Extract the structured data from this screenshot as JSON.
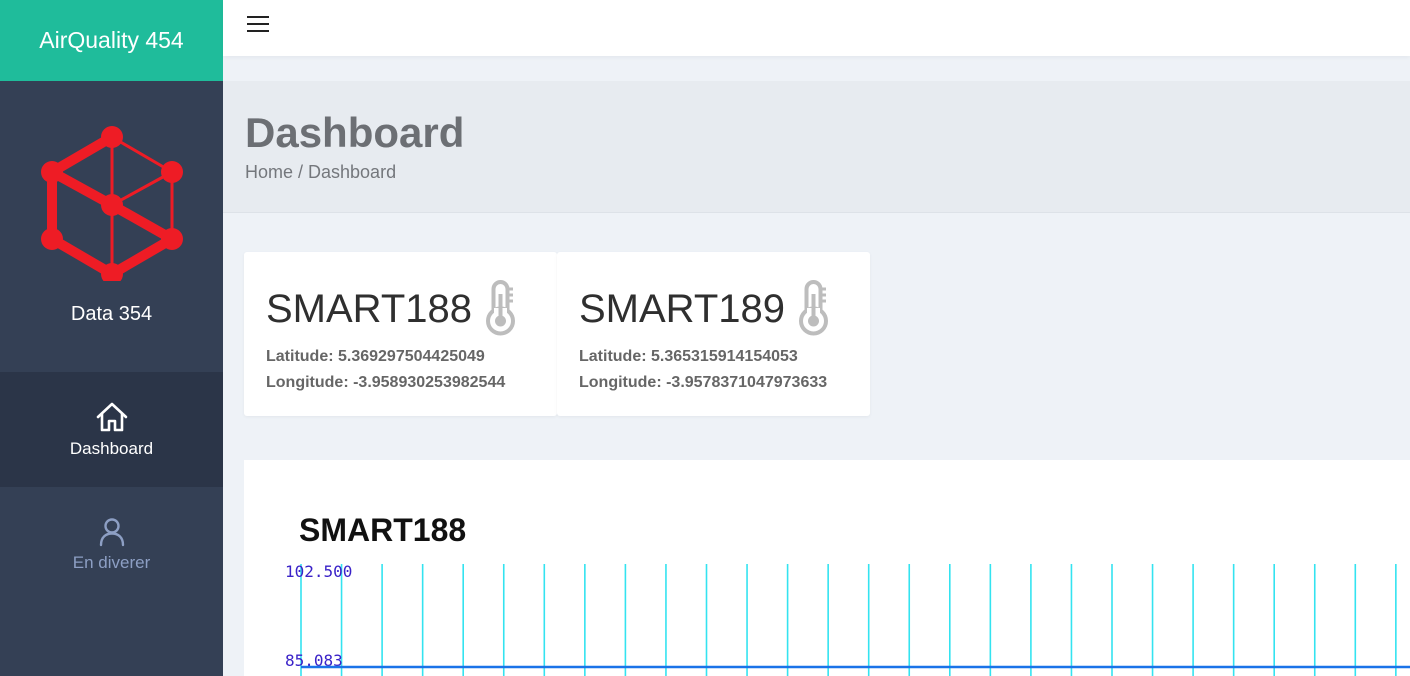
{
  "app": {
    "title": "AirQuality 454"
  },
  "sidebar": {
    "logo_label": "Data 354",
    "items": [
      {
        "label": "Dashboard",
        "icon": "home-icon",
        "active": true
      },
      {
        "label": "En diverer",
        "icon": "user-icon",
        "active": false
      }
    ]
  },
  "header": {
    "title": "Dashboard",
    "breadcrumb": "Home / Dashboard"
  },
  "devices": [
    {
      "name": "SMART188",
      "icon": "thermometer-icon",
      "latitude_text": "Latitude: 5.369297504425049",
      "longitude_text": "Longitude: -3.958930253982544"
    },
    {
      "name": "SMART189",
      "icon": "thermometer-icon",
      "latitude_text": "Latitude: 5.365315914154053",
      "longitude_text": "Longitude: -3.9578371047973633"
    }
  ],
  "colors": {
    "brand": "#1fbc9b",
    "sidebar": "#344055",
    "sidebar_active": "#2b3548",
    "logo": "#ee1c25",
    "grid": "#33e3f0",
    "series": "#1a73e8",
    "axis_labels": "#3a22c8"
  },
  "chart_data": {
    "type": "line",
    "title": "SMART188",
    "xlabel": "",
    "ylabel": "",
    "y_ticks": [
      "102.500",
      "85.083"
    ],
    "ylim": [
      85.083,
      102.5
    ],
    "grid": true,
    "series": [
      {
        "values": [
          85.083,
          85.083,
          85.083,
          85.083,
          85.083,
          85.083,
          85.083,
          85.083,
          85.083,
          85.083,
          85.083,
          85.083,
          85.083,
          85.083,
          85.083,
          85.083,
          85.083,
          85.083,
          85.083,
          85.083,
          85.083,
          85.083,
          85.083,
          85.083,
          85.083,
          85.083,
          85.083,
          85.083
        ]
      }
    ]
  }
}
